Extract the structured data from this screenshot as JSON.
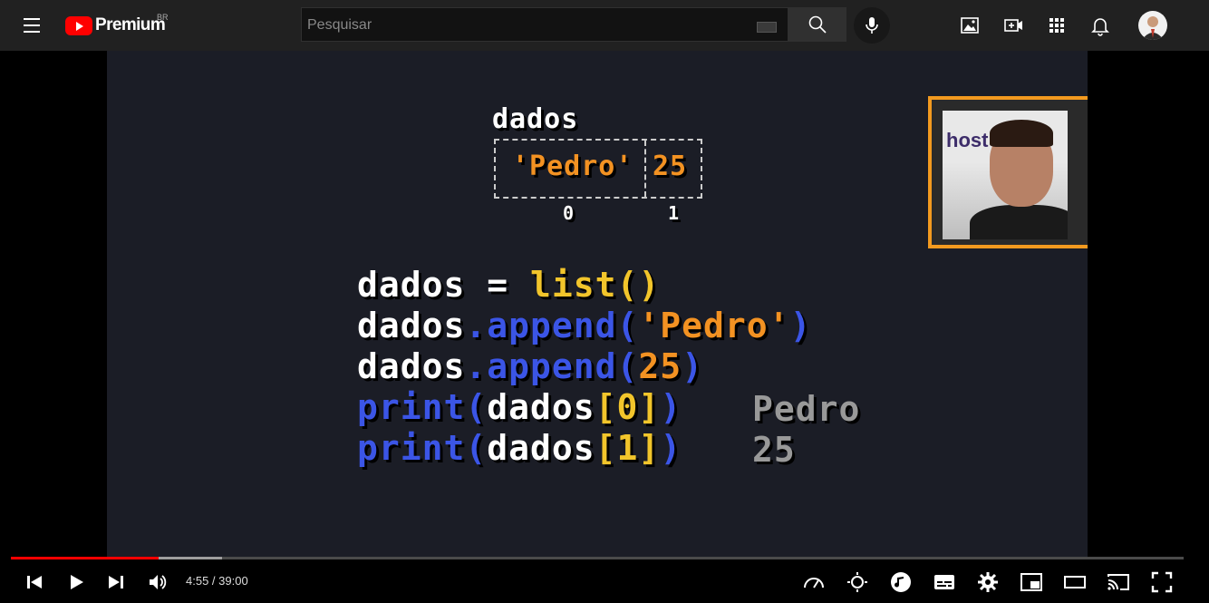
{
  "header": {
    "logo_text": "Premium",
    "region": "BR",
    "search_placeholder": "Pesquisar"
  },
  "slide": {
    "array_label": "dados",
    "cells": [
      "'Pedro'",
      "25"
    ],
    "indices": [
      "0",
      "1"
    ],
    "code_lines": [
      [
        {
          "t": "dados",
          "c": "w"
        },
        {
          "t": " = ",
          "c": "w"
        },
        {
          "t": "list()",
          "c": "y"
        }
      ],
      [
        {
          "t": "dados",
          "c": "w"
        },
        {
          "t": ".append(",
          "c": "b"
        },
        {
          "t": "'Pedro'",
          "c": "o"
        },
        {
          "t": ")",
          "c": "b"
        }
      ],
      [
        {
          "t": "dados",
          "c": "w"
        },
        {
          "t": ".append(",
          "c": "b"
        },
        {
          "t": "25",
          "c": "o"
        },
        {
          "t": ")",
          "c": "b"
        }
      ],
      [
        {
          "t": "print(",
          "c": "b"
        },
        {
          "t": "dados",
          "c": "w"
        },
        {
          "t": "[0]",
          "c": "y"
        },
        {
          "t": ")",
          "c": "b"
        }
      ],
      [
        {
          "t": "print(",
          "c": "b"
        },
        {
          "t": "dados",
          "c": "w"
        },
        {
          "t": "[1]",
          "c": "y"
        },
        {
          "t": ")",
          "c": "b"
        }
      ]
    ],
    "outputs": [
      "Pedro",
      "25"
    ],
    "webcam_logo_text": "host"
  },
  "player": {
    "time_display": "4:55 / 39:00",
    "played_fraction": 0.126,
    "buffered_fraction": 0.18
  },
  "colors": {
    "brand_red": "#ff0000",
    "code_white": "#ffffff",
    "code_yellow": "#f2c52b",
    "code_blue": "#3b55e6",
    "code_orange": "#f39222",
    "output_gray": "#999999"
  }
}
